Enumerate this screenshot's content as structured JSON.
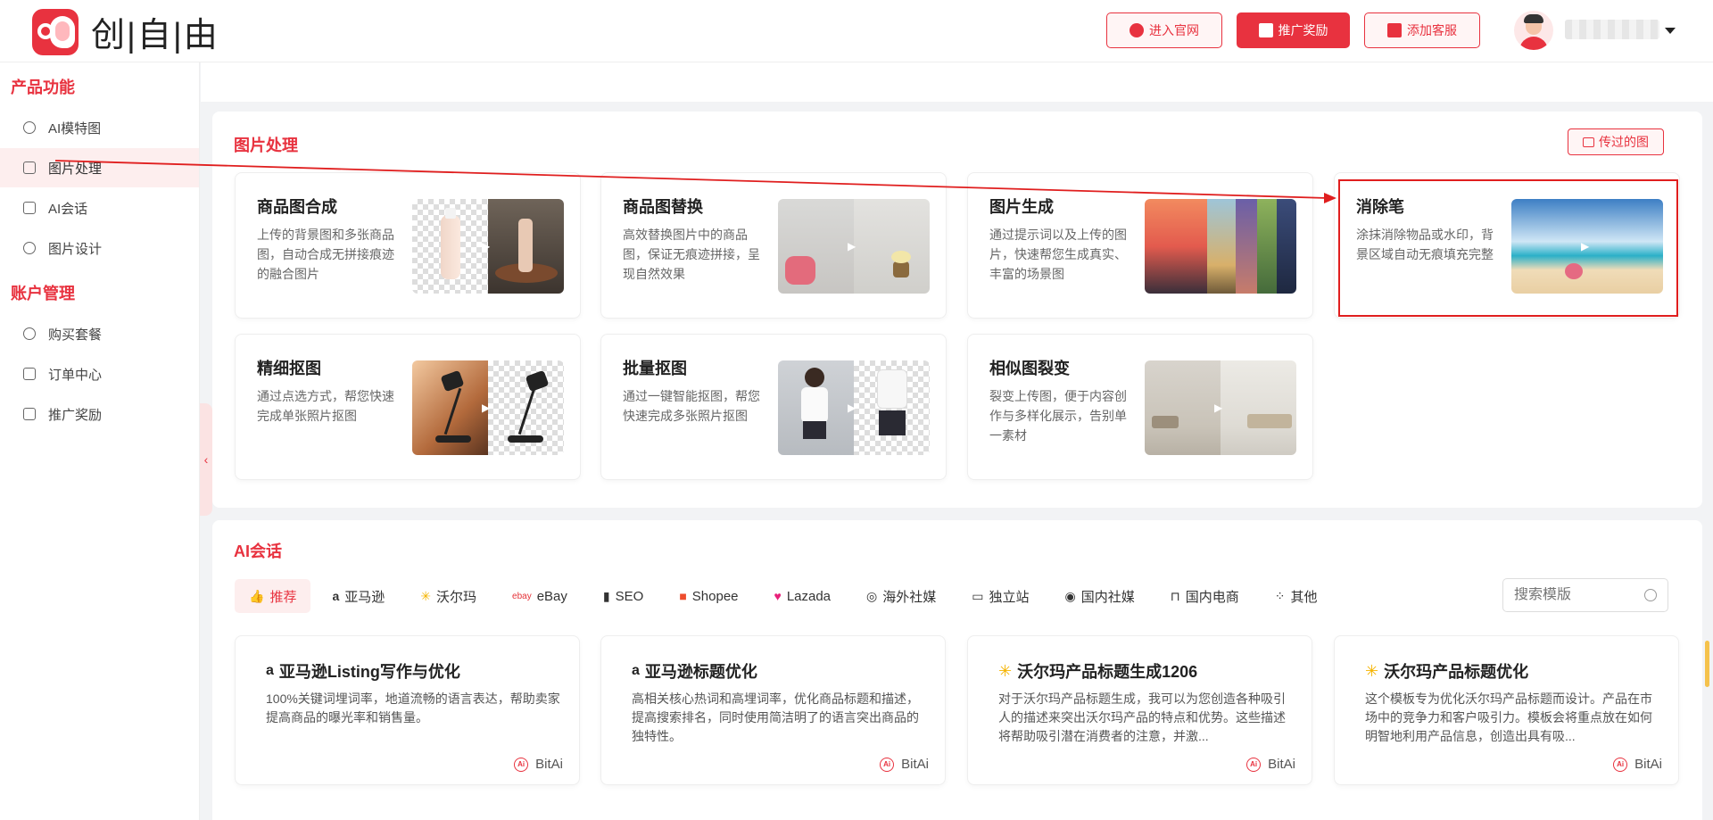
{
  "brand": {
    "name": "创|自|由",
    "accent": "#e8323f"
  },
  "header": {
    "buttons": [
      {
        "label": "进入官网",
        "icon": "globe-icon"
      },
      {
        "label": "推广奖励",
        "icon": "megaphone-icon"
      },
      {
        "label": "添加客服",
        "icon": "gift-icon"
      }
    ]
  },
  "sidebar": {
    "groups": [
      {
        "title": "产品功能",
        "items": [
          {
            "label": "AI模特图",
            "icon": "model-icon"
          },
          {
            "label": "图片处理",
            "icon": "image-icon",
            "active": true
          },
          {
            "label": "AI会话",
            "icon": "ai-chat-icon"
          },
          {
            "label": "图片设计",
            "icon": "design-icon"
          }
        ]
      },
      {
        "title": "账户管理",
        "items": [
          {
            "label": "购买套餐",
            "icon": "cart-icon"
          },
          {
            "label": "订单中心",
            "icon": "order-icon"
          },
          {
            "label": "推广奖励",
            "icon": "megaphone-icon"
          }
        ]
      }
    ]
  },
  "image_section": {
    "title": "图片处理",
    "upload_button": "传过的图",
    "cards": [
      {
        "title": "商品图合成",
        "desc": "上传的背景图和多张商品图，自动合成无拼接痕迹的融合图片"
      },
      {
        "title": "商品图替换",
        "desc": "高效替换图片中的商品图，保证无痕迹拼接，呈现自然效果"
      },
      {
        "title": "图片生成",
        "desc": "通过提示词以及上传的图片，快速帮您生成真实、丰富的场景图"
      },
      {
        "title": "消除笔",
        "desc": "涂抹消除物品或水印，背景区域自动无痕填充完整"
      },
      {
        "title": "精细抠图",
        "desc": "通过点选方式，帮您快速完成单张照片抠图"
      },
      {
        "title": "批量抠图",
        "desc": "通过一键智能抠图，帮您快速完成多张照片抠图"
      },
      {
        "title": "相似图裂变",
        "desc": "裂变上传图，便于内容创作与多样化展示，告别单一素材"
      }
    ]
  },
  "chat_section": {
    "title": "AI会话",
    "tabs": [
      {
        "label": "推荐",
        "icon": "thumbs-up-icon",
        "active": true
      },
      {
        "label": "亚马逊",
        "icon": "amazon-icon"
      },
      {
        "label": "沃尔玛",
        "icon": "walmart-icon"
      },
      {
        "label": "eBay",
        "icon": "ebay-icon"
      },
      {
        "label": "SEO",
        "icon": "bar-chart-icon"
      },
      {
        "label": "Shopee",
        "icon": "shopee-icon"
      },
      {
        "label": "Lazada",
        "icon": "lazada-icon"
      },
      {
        "label": "海外社媒",
        "icon": "globe-chat-icon"
      },
      {
        "label": "独立站",
        "icon": "store-icon"
      },
      {
        "label": "国内社媒",
        "icon": "chat-icon"
      },
      {
        "label": "国内电商",
        "icon": "bag-icon"
      },
      {
        "label": "其他",
        "icon": "grid-icon"
      }
    ],
    "search_placeholder": "搜索模版",
    "templates": [
      {
        "title": "亚马逊Listing写作与优化",
        "icon": "amazon-icon",
        "desc": "100%关键词埋词率，地道流畅的语言表达，帮助卖家提高商品的曝光率和销售量。",
        "author": "BitAi"
      },
      {
        "title": "亚马逊标题优化",
        "icon": "amazon-icon",
        "desc": "高相关核心热词和高埋词率，优化商品标题和描述，提高搜索排名，同时使用简洁明了的语言突出商品的独特性。",
        "author": "BitAi"
      },
      {
        "title": "沃尔玛产品标题生成1206",
        "icon": "walmart-icon",
        "desc": "对于沃尔玛产品标题生成，我可以为您创造各种吸引人的描述来突出沃尔玛产品的特点和优势。这些描述将帮助吸引潜在消费者的注意，并激...",
        "author": "BitAi"
      },
      {
        "title": "沃尔玛产品标题优化",
        "icon": "walmart-icon",
        "desc": "这个模板专为优化沃尔玛产品标题而设计。产品在市场中的竞争力和客户吸引力。模板会将重点放在如何明智地利用产品信息，创造出具有吸...",
        "author": "BitAi"
      }
    ]
  }
}
